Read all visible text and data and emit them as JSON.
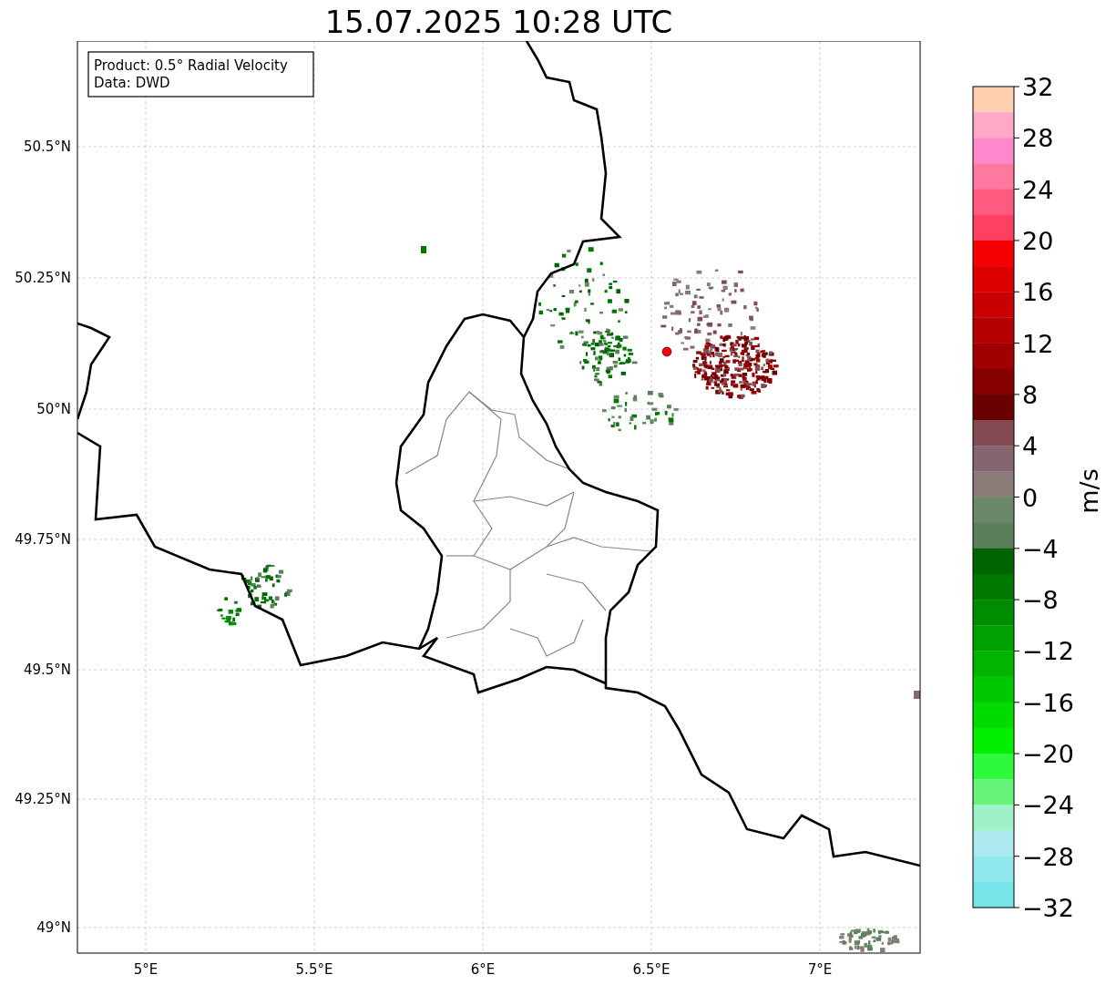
{
  "title": "15.07.2025 10:28 UTC",
  "legend": [
    "Product: 0.5° Radial Velocity",
    "Data: DWD"
  ],
  "x_ticks": [
    "5°E",
    "5.5°E",
    "6°E",
    "6.5°E",
    "7°E"
  ],
  "y_ticks": [
    "50.5°N",
    "50.25°N",
    "50°N",
    "49.75°N",
    "49.5°N",
    "49.25°N",
    "49°N"
  ],
  "colorbar": {
    "label": "m/s",
    "ticks": [
      "32",
      "28",
      "24",
      "20",
      "16",
      "12",
      "8",
      "4",
      "0",
      "−4",
      "−8",
      "−12",
      "−16",
      "−20",
      "−24",
      "−28",
      "−32"
    ],
    "bins": [
      {
        "color": "#ffcfb0"
      },
      {
        "color": "#ffa8c8"
      },
      {
        "color": "#ff88cc"
      },
      {
        "color": "#ff78a0"
      },
      {
        "color": "#ff5a80"
      },
      {
        "color": "#ff4060"
      },
      {
        "color": "#f50000"
      },
      {
        "color": "#dc0000"
      },
      {
        "color": "#c80000"
      },
      {
        "color": "#b40000"
      },
      {
        "color": "#a00000"
      },
      {
        "color": "#870000"
      },
      {
        "color": "#6b0000"
      },
      {
        "color": "#844a52"
      },
      {
        "color": "#866470"
      },
      {
        "color": "#8a7b78"
      },
      {
        "color": "#6b8868"
      },
      {
        "color": "#5a7f5a"
      },
      {
        "color": "#006400"
      },
      {
        "color": "#007800"
      },
      {
        "color": "#008c00"
      },
      {
        "color": "#00a000"
      },
      {
        "color": "#00b400"
      },
      {
        "color": "#00c800"
      },
      {
        "color": "#00dc00"
      },
      {
        "color": "#00f000"
      },
      {
        "color": "#2dfa3c"
      },
      {
        "color": "#66f57a"
      },
      {
        "color": "#9ef2c8"
      },
      {
        "color": "#ade8ee"
      },
      {
        "color": "#90e8ec"
      },
      {
        "color": "#76e4e8"
      }
    ]
  }
}
